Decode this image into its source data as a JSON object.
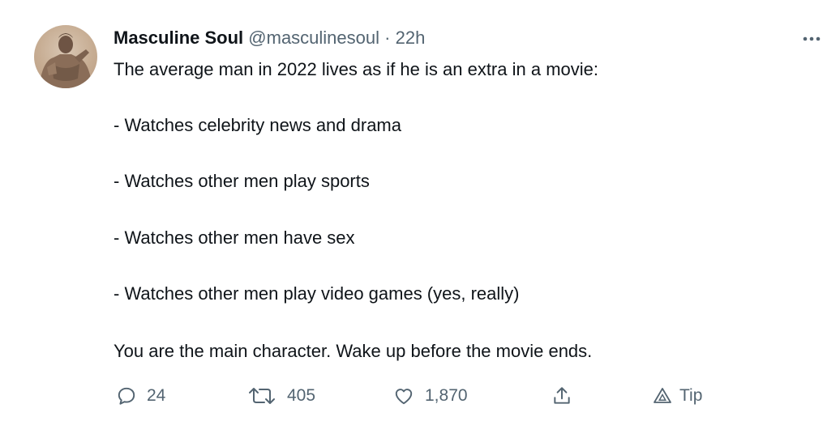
{
  "author": {
    "name": "Masculine Soul",
    "handle": "@masculinesoul",
    "separator": "·",
    "time": "22h"
  },
  "tweet": {
    "lines": [
      "The average man in 2022 lives as if he is an extra in a movie:",
      "- Watches celebrity news and drama",
      "- Watches other men play sports",
      "- Watches other men have sex",
      "- Watches other men play video games (yes, really)",
      "You are the main character. Wake up before the movie ends."
    ]
  },
  "actions": {
    "reply": {
      "icon": "reply-icon",
      "count": "24"
    },
    "retweet": {
      "icon": "retweet-icon",
      "count": "405"
    },
    "like": {
      "icon": "heart-icon",
      "count": "1,870"
    },
    "share": {
      "icon": "share-icon"
    },
    "tip": {
      "icon": "tip-icon",
      "label": "Tip"
    }
  },
  "colors": {
    "text": "#0f1419",
    "secondary": "#536471",
    "background": "#ffffff"
  }
}
